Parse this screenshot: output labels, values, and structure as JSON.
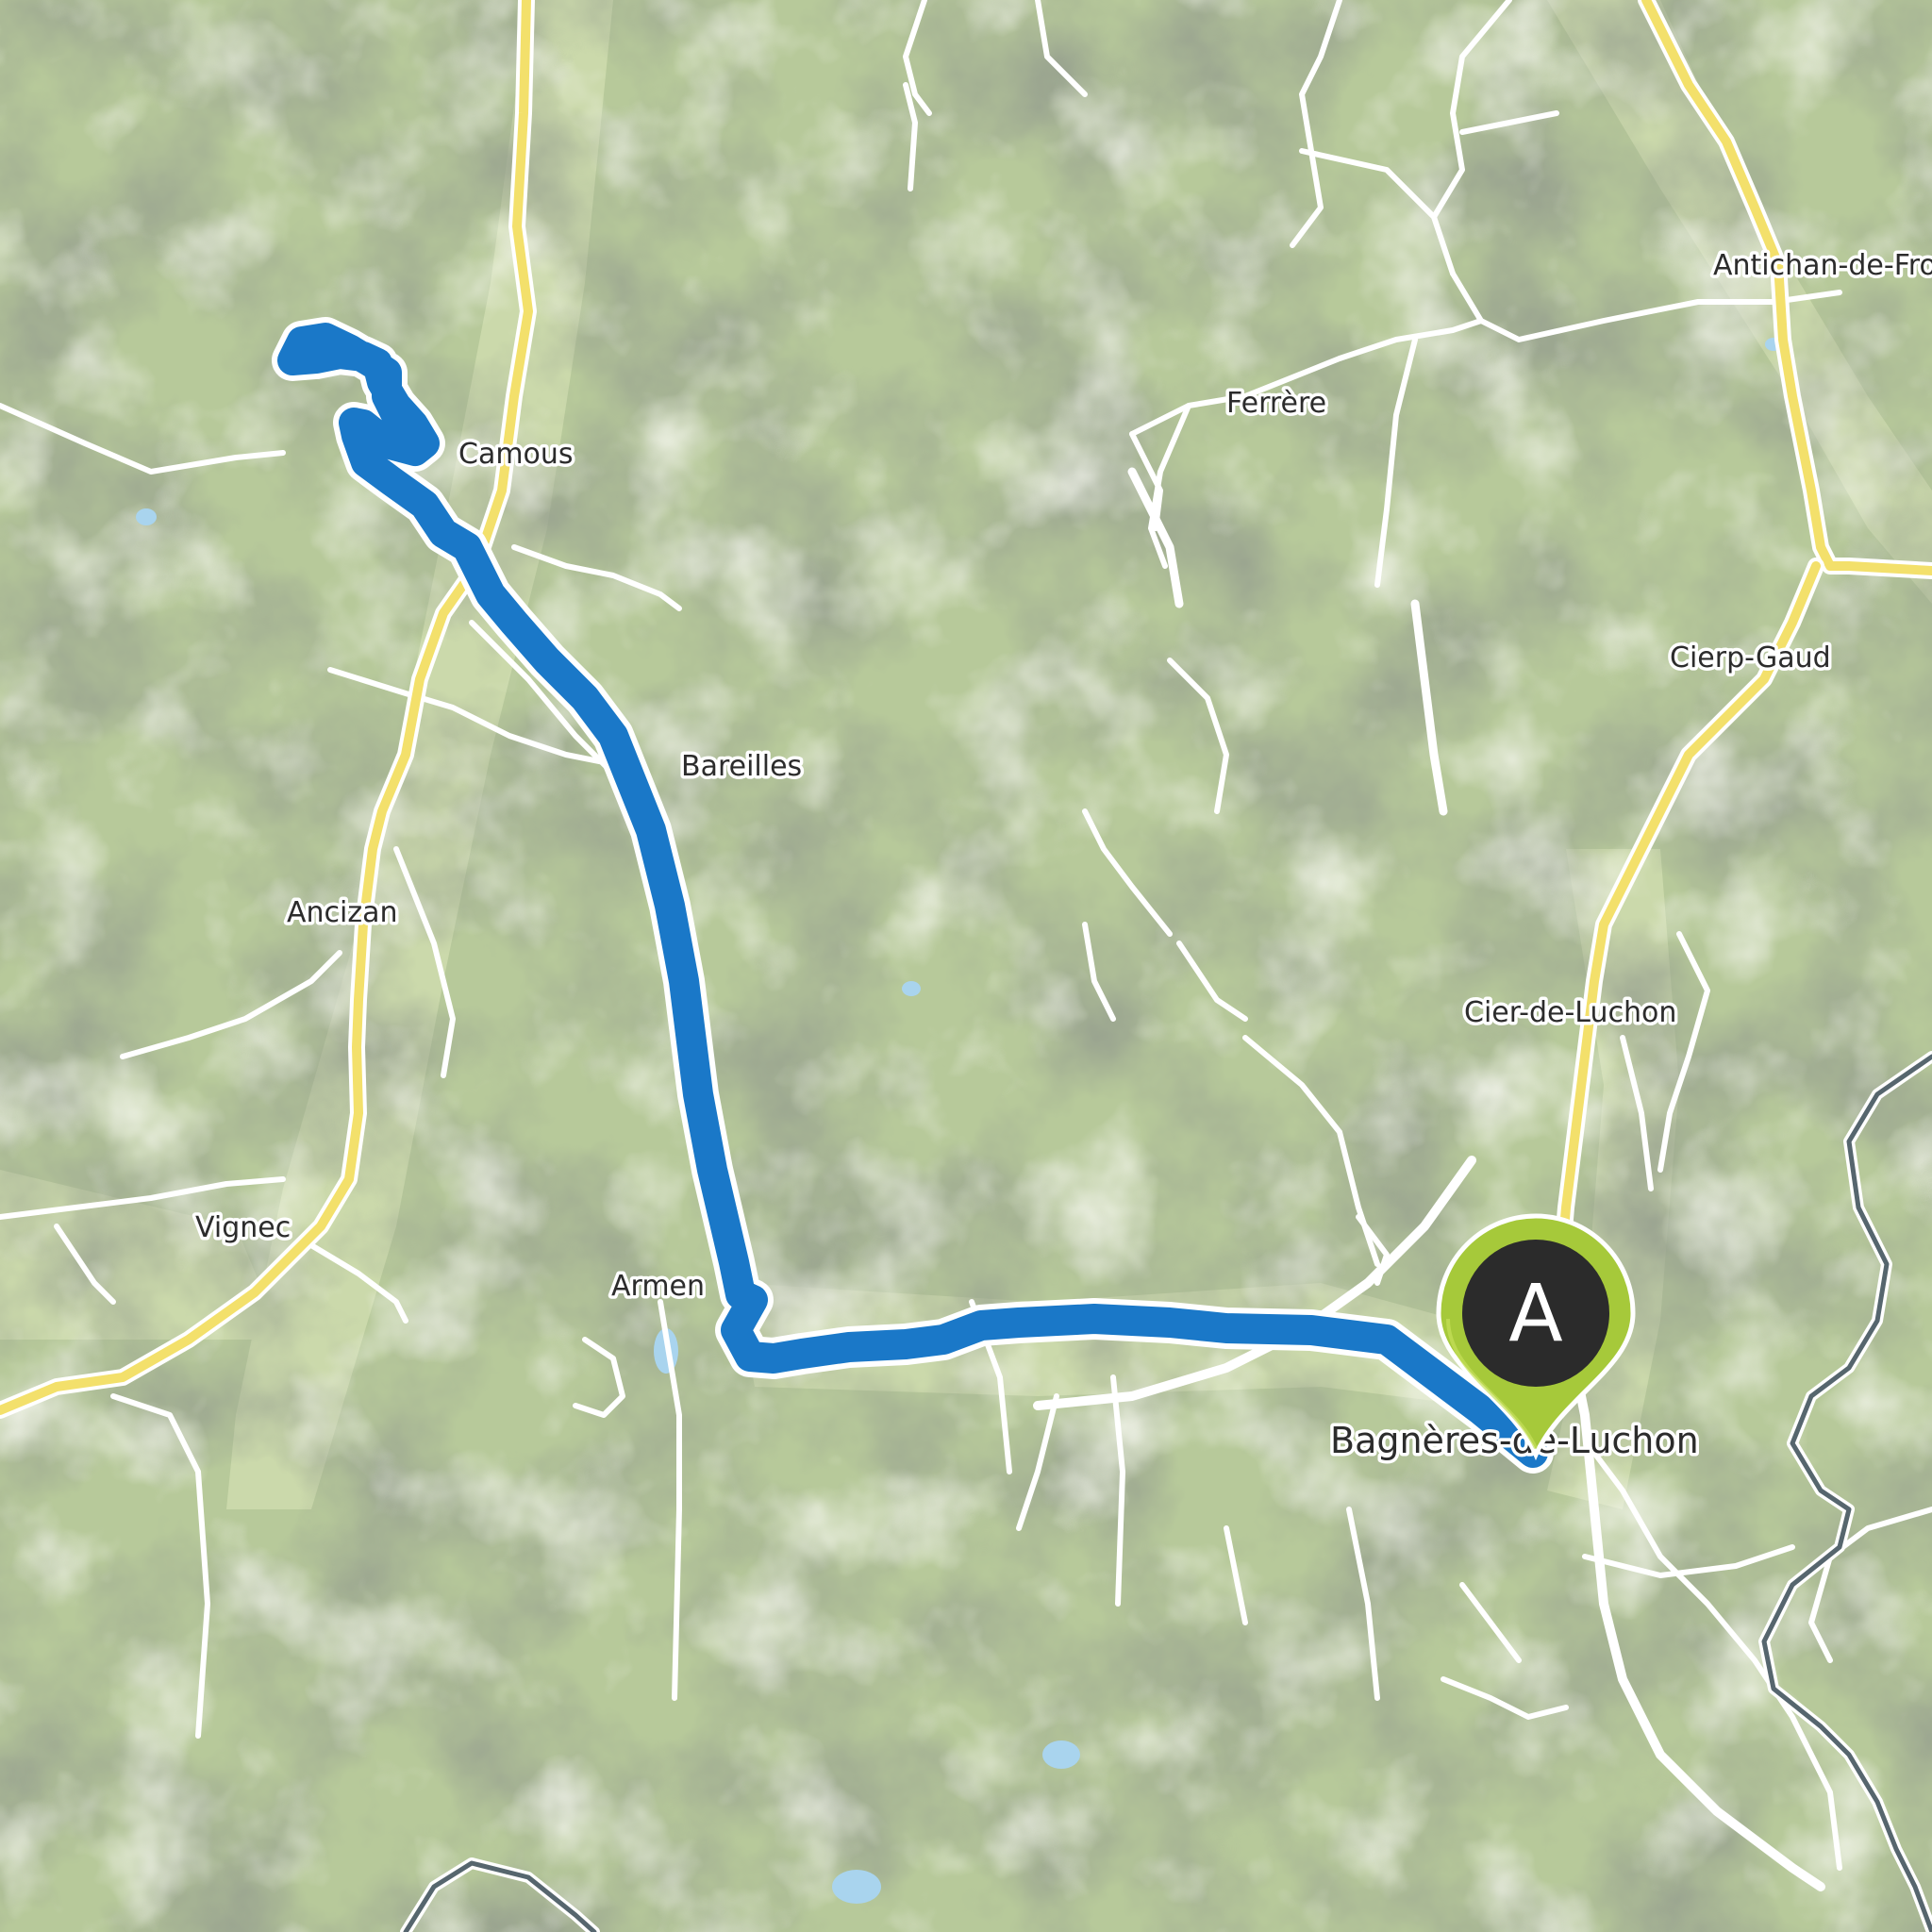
{
  "map": {
    "colors": {
      "base": "#b7c99a",
      "valley": "#cfdcae",
      "shade": "#8f9c83",
      "road": "#ffffff",
      "major_road": "#f3e06b",
      "route": "#1a78c8",
      "border": "#56666e",
      "water": "#a9d4ee",
      "marker": "#a6c93a",
      "marker_inner": "#2b2b2b"
    },
    "places": [
      {
        "id": "camous",
        "label": "Camous"
      },
      {
        "id": "ferrere",
        "label": "Ferrère"
      },
      {
        "id": "antichan",
        "label": "Antichan-de-Fro"
      },
      {
        "id": "cierp-gaud",
        "label": "Cierp-Gaud"
      },
      {
        "id": "bareilles",
        "label": "Bareilles"
      },
      {
        "id": "ancizan",
        "label": "Ancizan"
      },
      {
        "id": "cier-de-luchon",
        "label": "Cier-de-Luchon"
      },
      {
        "id": "vignec",
        "label": "Vignec"
      },
      {
        "id": "armenteule",
        "label": "Armen"
      },
      {
        "id": "bagneres",
        "label": "Bagnères-de-Luchon"
      }
    ],
    "start_marker": {
      "letter": "A",
      "icon": "map-pin-icon"
    }
  }
}
